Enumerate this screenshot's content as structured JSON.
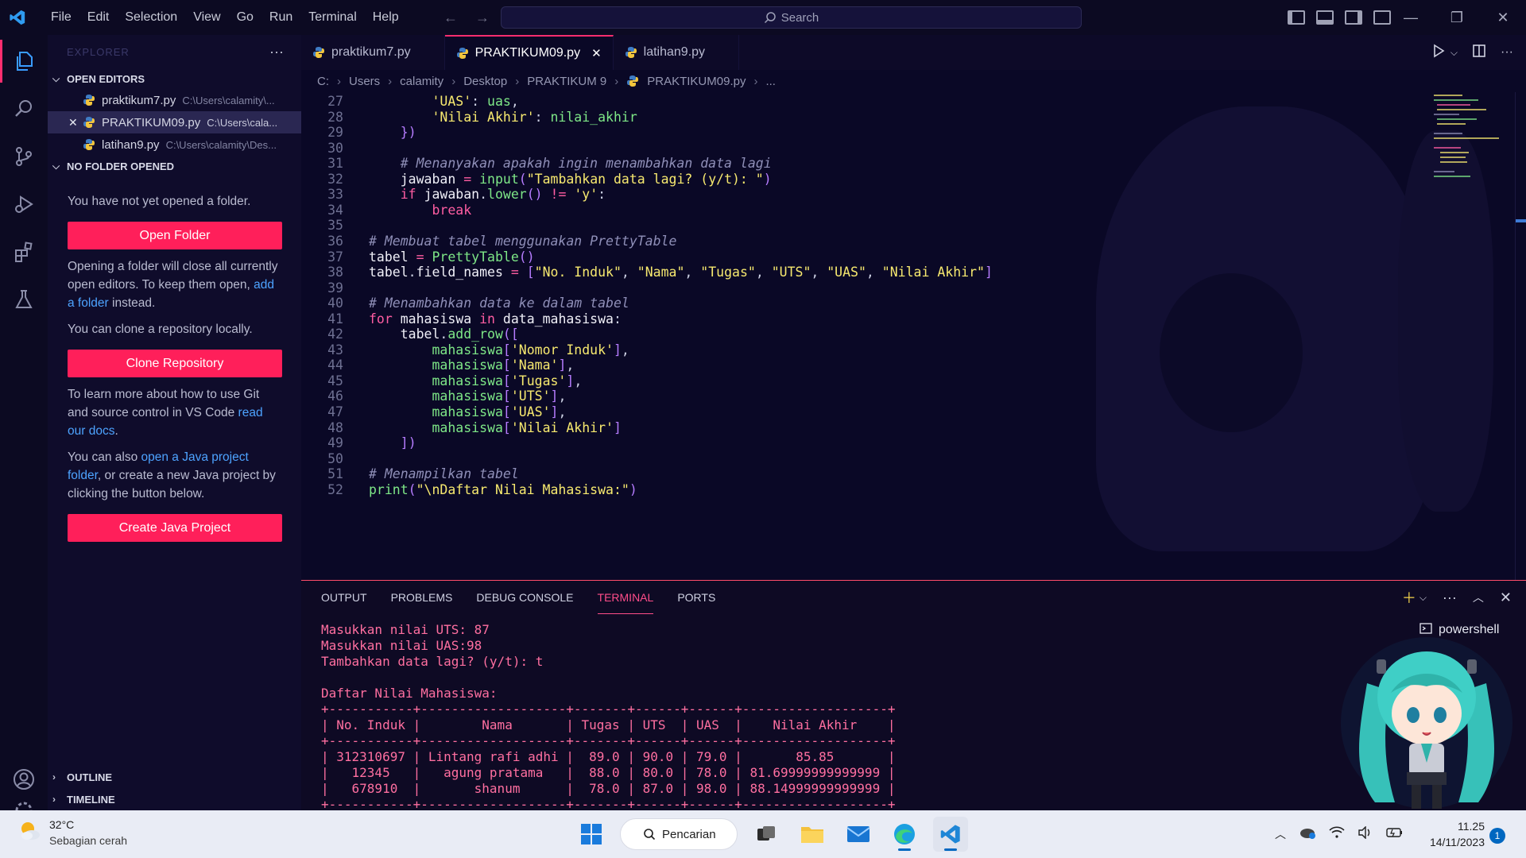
{
  "menu": [
    "File",
    "Edit",
    "Selection",
    "View",
    "Go",
    "Run",
    "Terminal",
    "Help"
  ],
  "search": {
    "placeholder": "Search"
  },
  "sidebar": {
    "title": "EXPLORER",
    "open_editors": "OPEN EDITORS",
    "editors": [
      {
        "name": "praktikum7.py",
        "path": "C:\\Users\\calamity\\..."
      },
      {
        "name": "PRAKTIKUM09.py",
        "path": "C:\\Users\\cala..."
      },
      {
        "name": "latihan9.py",
        "path": "C:\\Users\\calamity\\Des..."
      }
    ],
    "no_folder": "NO FOLDER OPENED",
    "msg1": "You have not yet opened a folder.",
    "open_folder": "Open Folder",
    "msg2_a": "Opening a folder will close all currently open editors. To keep them open,",
    "msg2_link": "add a folder",
    "msg2_b": "instead.",
    "msg3": "You can clone a repository locally.",
    "clone": "Clone Repository",
    "msg4_a": "To learn more about how to use Git and source control in VS Code",
    "msg4_link": "read our docs",
    "msg4_b": ".",
    "msg5_a": "You can also",
    "msg5_link": "open a Java project folder",
    "msg5_b": ", or create a new Java project by clicking the button below.",
    "create_java": "Create Java Project",
    "outline": "OUTLINE",
    "timeline": "TIMELINE"
  },
  "tabs": [
    {
      "label": "praktikum7.py"
    },
    {
      "label": "PRAKTIKUM09.py"
    },
    {
      "label": "latihan9.py"
    }
  ],
  "breadcrumb": [
    "C:",
    "Users",
    "calamity",
    "Desktop",
    "PRAKTIKUM 9",
    "PRAKTIKUM09.py",
    "..."
  ],
  "code": [
    {
      "n": "27",
      "t": "        'UAS': uas,"
    },
    {
      "n": "28",
      "t": "        'Nilai Akhir': nilai_akhir"
    },
    {
      "n": "29",
      "t": "    })"
    },
    {
      "n": "30",
      "t": ""
    },
    {
      "n": "31",
      "t": "    # Menanyakan apakah ingin menambahkan data lagi"
    },
    {
      "n": "32",
      "t": "    jawaban = input(\"Tambahkan data lagi? (y/t): \")"
    },
    {
      "n": "33",
      "t": "    if jawaban.lower() != 'y':"
    },
    {
      "n": "34",
      "t": "        break"
    },
    {
      "n": "35",
      "t": ""
    },
    {
      "n": "36",
      "t": "# Membuat tabel menggunakan PrettyTable"
    },
    {
      "n": "37",
      "t": "tabel = PrettyTable()"
    },
    {
      "n": "38",
      "t": "tabel.field_names = [\"No. Induk\", \"Nama\", \"Tugas\", \"UTS\", \"UAS\", \"Nilai Akhir\"]"
    },
    {
      "n": "39",
      "t": ""
    },
    {
      "n": "40",
      "t": "# Menambahkan data ke dalam tabel"
    },
    {
      "n": "41",
      "t": "for mahasiswa in data_mahasiswa:"
    },
    {
      "n": "42",
      "t": "    tabel.add_row(["
    },
    {
      "n": "43",
      "t": "        mahasiswa['Nomor Induk'],"
    },
    {
      "n": "44",
      "t": "        mahasiswa['Nama'],"
    },
    {
      "n": "45",
      "t": "        mahasiswa['Tugas'],"
    },
    {
      "n": "46",
      "t": "        mahasiswa['UTS'],"
    },
    {
      "n": "47",
      "t": "        mahasiswa['UAS'],"
    },
    {
      "n": "48",
      "t": "        mahasiswa['Nilai Akhir']"
    },
    {
      "n": "49",
      "t": "    ])"
    },
    {
      "n": "50",
      "t": ""
    },
    {
      "n": "51",
      "t": "# Menampilkan tabel"
    },
    {
      "n": "52",
      "t": "print(\"\\nDaftar Nilai Mahasiswa:\")"
    }
  ],
  "panel": {
    "tabs": [
      "OUTPUT",
      "PROBLEMS",
      "DEBUG CONSOLE",
      "TERMINAL",
      "PORTS"
    ],
    "active_tab": "TERMINAL",
    "terminal_name": "powershell",
    "terminal_lines": [
      "Masukkan nilai UTS: 87",
      "Masukkan nilai UAS:98",
      "Tambahkan data lagi? (y/t): t",
      "",
      "Daftar Nilai Mahasiswa:",
      "+-----------+-------------------+-------+------+------+-------------------+",
      "| No. Induk |        Nama       | Tugas | UTS  | UAS  |    Nilai Akhir    |",
      "+-----------+-------------------+-------+------+------+-------------------+",
      "| 312310697 | Lintang rafi adhi |  89.0 | 90.0 | 79.0 |       85.85       |",
      "|   12345   |   agung pratama   |  88.0 | 80.0 | 78.0 | 81.69999999999999 |",
      "|   678910  |       shanum      |  78.0 | 87.0 | 98.0 | 88.14999999999999 |",
      "+-----------+-------------------+-------+------+------+-------------------+"
    ]
  },
  "taskbar": {
    "temp": "32°C",
    "condition": "Sebagian cerah",
    "search_label": "Pencarian",
    "time": "11.25",
    "date": "14/11/2023",
    "notifications": "1"
  },
  "colors": {
    "accent": "#ff1f5a",
    "tab_active_border": "#ff2d6f",
    "terminal_text": "#ff6fa0"
  }
}
